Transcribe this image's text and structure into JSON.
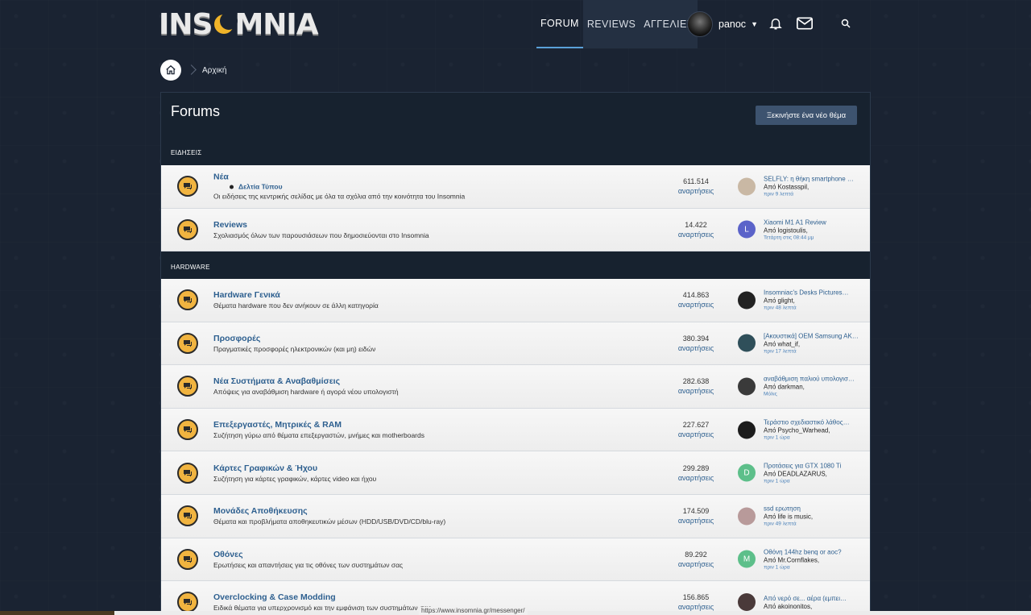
{
  "brand": {
    "logo_left": "INS",
    "logo_right": "MNIA"
  },
  "nav": {
    "tabs": [
      {
        "label": "FORUM",
        "active": true
      },
      {
        "label": "REVIEWS",
        "active": false
      },
      {
        "label": "ΑΓΓΕΛΙΕΣ",
        "active": false
      }
    ],
    "username": "panoc",
    "icons": [
      "bell-icon",
      "envelope-icon",
      "search-icon"
    ]
  },
  "breadcrumb": {
    "home_icon": "home-icon",
    "current": "Αρχική"
  },
  "page": {
    "title": "Forums",
    "new_topic_label": "Ξεκινήστε ένα νέο θέμα"
  },
  "categories": [
    {
      "title": "ΕΙΔΗΣΕΙΣ",
      "forums": [
        {
          "name": "Νέα",
          "subforum": "Δελτία Τύπου",
          "desc": "Οι ειδήσεις της κεντρικής σελίδας με όλα τα σχόλια από την κοινότητα του Insomnia",
          "count": "611.514",
          "count_label": "αναρτήσεις",
          "last_title": "SELFLY: η θήκη smartphone …",
          "last_by": "Από Kostasspil,",
          "last_time": "πριν 9 λεπτά",
          "avatar_letter": "",
          "avatar_color": "#c9b8a4"
        },
        {
          "name": "Reviews",
          "desc": "Σχολιασμός όλων των παρουσιάσεων που δημοσιεύονται στο Insomnia",
          "count": "14.422",
          "count_label": "αναρτήσεις",
          "last_title": "Xiaomi M1 A1 Review",
          "last_by": "Από logistoulis,",
          "last_time": "Τετάρτη στις 08:44 μμ",
          "avatar_letter": "L",
          "avatar_color": "#5b63c9"
        }
      ]
    },
    {
      "title": "HARDWARE",
      "forums": [
        {
          "name": "Hardware Γενικά",
          "desc": "Θέματα hardware που δεν ανήκουν σε άλλη κατηγορία",
          "count": "414.863",
          "count_label": "αναρτήσεις",
          "last_title": "Insomniac's Desks Pictures…",
          "last_by": "Από glight,",
          "last_time": "πριν 48 λεπτά",
          "avatar_letter": "",
          "avatar_color": "#222222"
        },
        {
          "name": "Προσφορές",
          "desc": "Πραγματικές προσφορές ηλεκτρονικών (και μη) ειδών",
          "count": "380.394",
          "count_label": "αναρτήσεις",
          "last_title": "[Ακουστικά] OEM Samsung AK…",
          "last_by": "Από what_if,",
          "last_time": "πριν 17 λεπτά",
          "avatar_letter": "",
          "avatar_color": "#2f4f5a"
        },
        {
          "name": "Νέα Συστήματα & Αναβαθμίσεις",
          "desc": "Απόψεις για αναβάθμιση hardware ή αγορά νέου υπολογιστή",
          "count": "282.638",
          "count_label": "αναρτήσεις",
          "last_title": "αναβάθμιση παλιού υπολογισ…",
          "last_by": "Από darkman,",
          "last_time": "Μόλις",
          "avatar_letter": "",
          "avatar_color": "#3a3a3a"
        },
        {
          "name": "Επεξεργαστές, Μητρικές & RAM",
          "desc": "Συζήτηση γύρω από θέματα επεξεργαστών, μνήμες και motherboards",
          "count": "227.627",
          "count_label": "αναρτήσεις",
          "last_title": "Τεράστιο σχεδιαστικό λάθος…",
          "last_by": "Από Psycho_Warhead,",
          "last_time": "πριν 1 ώρα",
          "avatar_letter": "",
          "avatar_color": "#1c1c1c"
        },
        {
          "name": "Κάρτες Γραφικών & Ήχου",
          "desc": "Συζήτηση για κάρτες γραφικών, κάρτες video και ήχου",
          "count": "299.289",
          "count_label": "αναρτήσεις",
          "last_title": "Προτάσεις για GTX 1080 Ti",
          "last_by": "Από DEADLAZARUS,",
          "last_time": "πριν 1 ώρα",
          "avatar_letter": "D",
          "avatar_color": "#5dbf8a"
        },
        {
          "name": "Μονάδες Αποθήκευσης",
          "desc": "Θέματα και προβλήματα αποθηκευτικών μέσων (HDD/USB/DVD/CD/blu-ray)",
          "count": "174.509",
          "count_label": "αναρτήσεις",
          "last_title": "ssd ερωτηση",
          "last_by": "Από life is music,",
          "last_time": "πριν 49 λεπτά",
          "avatar_letter": "",
          "avatar_color": "#b89a9a"
        },
        {
          "name": "Οθόνες",
          "desc": "Ερωτήσεις και απαντήσεις για τις οθόνες των συστημάτων σας",
          "count": "89.292",
          "count_label": "αναρτήσεις",
          "last_title": "Οθόνη 144hz benq or aoc?",
          "last_by": "Από Mr.Cornflakes,",
          "last_time": "πριν 1 ώρα",
          "avatar_letter": "M",
          "avatar_color": "#5dbf8a"
        },
        {
          "name": "Overclocking & Case Modding",
          "desc": "Ειδικά θέματα για υπερχρονισμό και την εμφάνιση των συστημάτων σας",
          "count": "156.865",
          "count_label": "αναρτήσεις",
          "last_title": "Από νερό σε... αέρα (εμπει…",
          "last_by": "Από akoinonitos,",
          "last_time": "",
          "avatar_letter": "",
          "avatar_color": "#4a3a3a"
        }
      ]
    }
  ],
  "status_bar": {
    "url": "https://www.insomnia.gr/messenger/"
  }
}
